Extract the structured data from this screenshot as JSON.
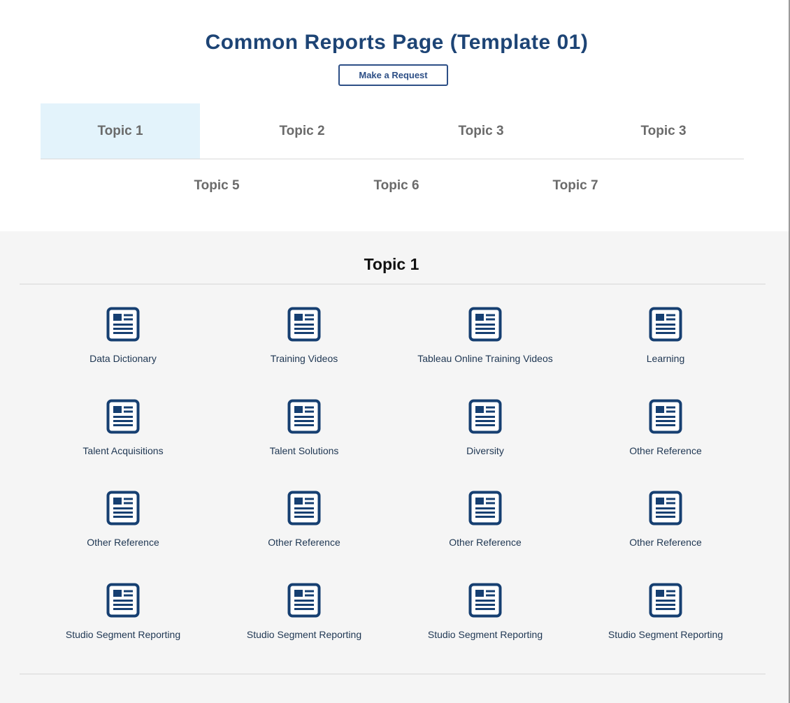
{
  "page": {
    "title": "Common Reports Page (Template 01)",
    "request_button": "Make a Request"
  },
  "tabs": [
    {
      "label": "Topic 1",
      "active": true
    },
    {
      "label": "Topic 2",
      "active": false
    },
    {
      "label": "Topic 3",
      "active": false
    },
    {
      "label": "Topic 3",
      "active": false
    },
    {
      "label": "Topic 5",
      "active": false
    },
    {
      "label": "Topic 6",
      "active": false
    },
    {
      "label": "Topic 7",
      "active": false
    }
  ],
  "section": {
    "title": "Topic 1",
    "items": [
      {
        "label": "Data Dictionary",
        "icon": "document-icon"
      },
      {
        "label": "Training Videos",
        "icon": "document-icon"
      },
      {
        "label": "Tableau Online Training Videos",
        "icon": "document-icon"
      },
      {
        "label": "Learning",
        "icon": "document-icon"
      },
      {
        "label": "Talent Acquisitions",
        "icon": "document-icon"
      },
      {
        "label": "Talent Solutions",
        "icon": "document-icon"
      },
      {
        "label": "Diversity",
        "icon": "document-icon"
      },
      {
        "label": "Other Reference",
        "icon": "document-icon"
      },
      {
        "label": "Other Reference",
        "icon": "document-icon"
      },
      {
        "label": "Other Reference",
        "icon": "document-icon"
      },
      {
        "label": "Other Reference",
        "icon": "document-icon"
      },
      {
        "label": "Other Reference",
        "icon": "document-icon"
      },
      {
        "label": "Studio Segment Reporting",
        "icon": "document-icon"
      },
      {
        "label": "Studio Segment Reporting",
        "icon": "document-icon"
      },
      {
        "label": "Studio Segment Reporting",
        "icon": "document-icon"
      },
      {
        "label": "Studio Segment Reporting",
        "icon": "document-icon"
      }
    ]
  },
  "colors": {
    "brand": "#1d4475",
    "icon": "#163f71",
    "active_tab_bg": "#e3f3fb",
    "content_bg": "#f5f5f5"
  }
}
